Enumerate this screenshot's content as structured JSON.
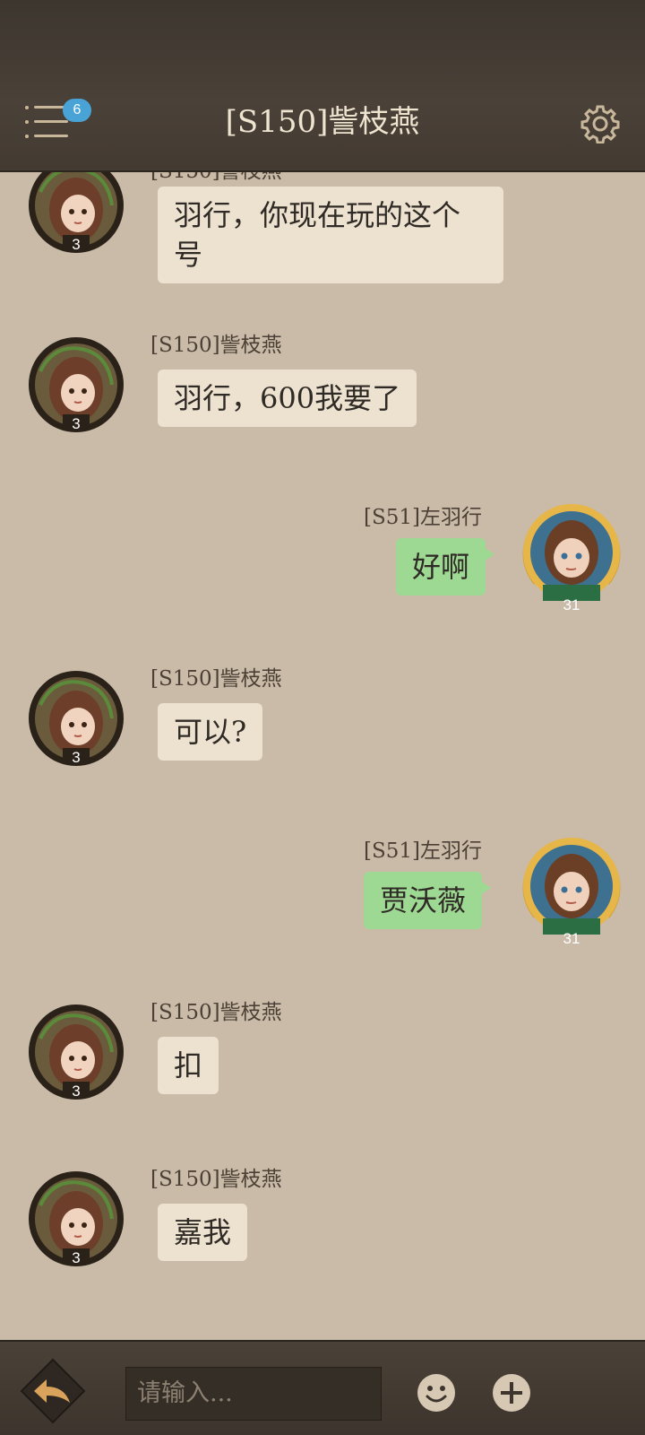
{
  "header": {
    "title": "[S150]訾枝燕",
    "menu_badge": "6",
    "menu_icon": "menu-icon",
    "settings_icon": "gear-icon"
  },
  "messages": [
    {
      "side": "left",
      "name": "[S150]訾枝燕",
      "text": "羽行，你现在玩的这个号",
      "level": "3"
    },
    {
      "side": "left",
      "name": "[S150]訾枝燕",
      "text": "羽行，600我要了",
      "level": "3"
    },
    {
      "side": "right",
      "name": "[S51]左羽行",
      "text": "好啊",
      "level": "31"
    },
    {
      "side": "left",
      "name": "[S150]訾枝燕",
      "text": "可以?",
      "level": "3"
    },
    {
      "side": "right",
      "name": "[S51]左羽行",
      "text": "贾沃薇",
      "level": "31"
    },
    {
      "side": "left",
      "name": "[S150]訾枝燕",
      "text": "扣",
      "level": "3"
    },
    {
      "side": "left",
      "name": "[S150]訾枝燕",
      "text": "嘉我",
      "level": "3"
    }
  ],
  "footer": {
    "input_placeholder": "请输入...",
    "back_icon": "back-arrow-icon",
    "emoji_icon": "smiley-icon",
    "add_icon": "plus-icon"
  },
  "colors": {
    "background": "#c9bba7",
    "header": "#433a31",
    "left_bubble": "#ece2cf",
    "right_bubble": "#9ed993",
    "badge": "#4aa3d6"
  }
}
